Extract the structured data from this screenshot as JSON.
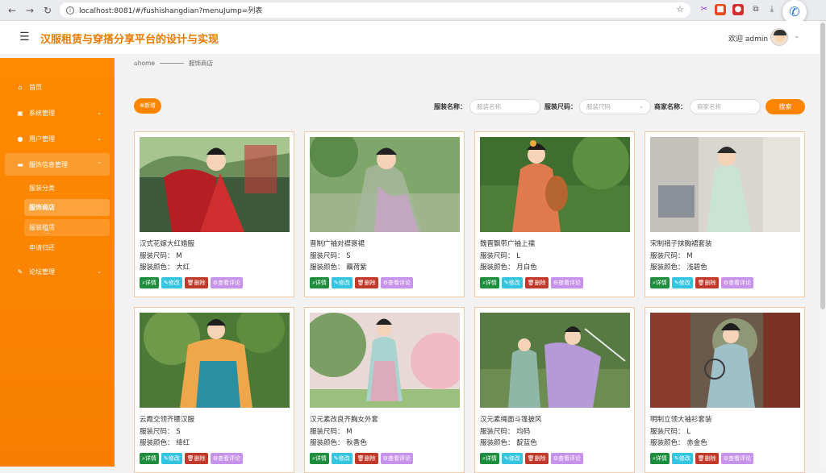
{
  "browser": {
    "url": "localhost:8081/#/fushishangdian?menuJump=列表"
  },
  "header": {
    "title": "汉服租赁与穿搭分享平台的设计与实现",
    "welcome": "欢迎 admin"
  },
  "sidebar": {
    "items": [
      {
        "label": "首页",
        "icon": "home-icon"
      },
      {
        "label": "系统管理",
        "icon": "system-icon"
      },
      {
        "label": "用户管理",
        "icon": "user-icon"
      },
      {
        "label": "服饰信息管理",
        "icon": "clothing-icon"
      },
      {
        "label": "论坛管理",
        "icon": "forum-icon"
      }
    ],
    "subitems": [
      "服装分类",
      "服饰商店",
      "服装租赁",
      "申请归还"
    ]
  },
  "breadcrumb": {
    "home": "home",
    "current": "服饰商店"
  },
  "toolbar": {
    "add_label": "新增",
    "name_label": "服装名称：",
    "name_placeholder": "服装名称",
    "size_label": "服装尺码：",
    "size_placeholder": "服装尺码",
    "merchant_label": "商家名称：",
    "merchant_placeholder": "商家名称",
    "search_label": "搜索"
  },
  "card_buttons": {
    "detail": "详情",
    "edit": "修改",
    "delete": "删除",
    "review": "查看评论"
  },
  "products": [
    {
      "name": "汉式花嫁大红婚服",
      "size": "服装尺码：  M",
      "color": "服装颜色：  大红"
    },
    {
      "name": "晋制广袖对襟褒裙",
      "size": "服装尺码：  S",
      "color": "服装颜色：  藕荷紫"
    },
    {
      "name": "魏晋飘带广袖上襦",
      "size": "服装尺码：  L",
      "color": "服装颜色：  月白色"
    },
    {
      "name": "宋制褙子抹胸裙套装",
      "size": "服装尺码：  M",
      "color": "服装颜色：  浅碧色"
    },
    {
      "name": "云霞交领齐腰汉服",
      "size": "服装尺码：  S",
      "color": "服装颜色：  绛红"
    },
    {
      "name": "汉元素改良齐胸女外套",
      "size": "服装尺码：  M",
      "color": "服装颜色：  秋香色"
    },
    {
      "name": "汉元素绳面斗篷披风",
      "size": "服装尺码：  均码",
      "color": "服装颜色：  靛蓝色"
    },
    {
      "name": "明制立领大袖衫套装",
      "size": "服装尺码：  L",
      "color": "服装颜色：  赤金色"
    }
  ],
  "colors": {
    "accent": "#ff8400",
    "title": "#e87a00",
    "detail_btn": "#1e8e3e",
    "edit_btn": "#36c5e0",
    "delete_btn": "#c0392b",
    "review_btn": "#c792ea"
  }
}
